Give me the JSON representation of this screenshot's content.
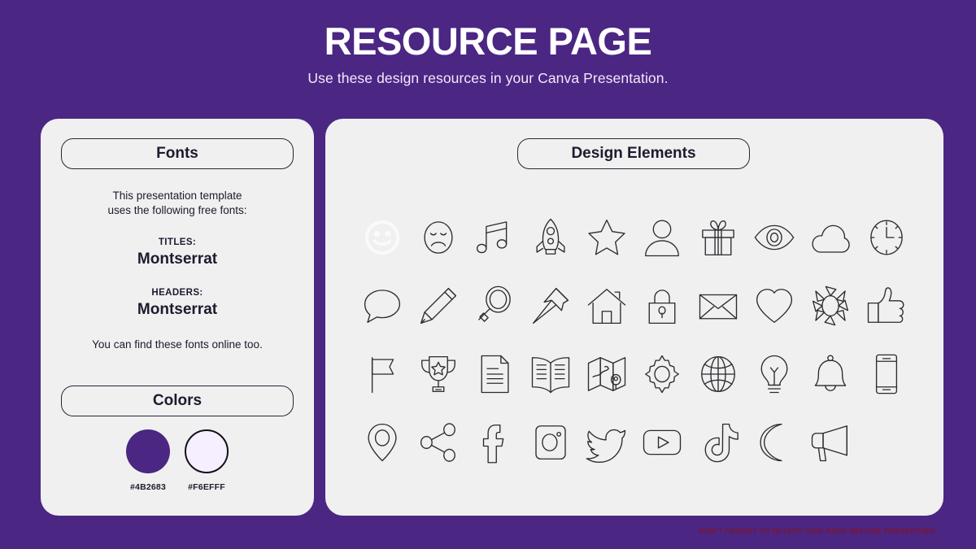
{
  "header": {
    "title": "RESOURCE PAGE",
    "subtitle": "Use these design resources in your Canva Presentation."
  },
  "fonts_panel": {
    "heading": "Fonts",
    "intro": "This presentation template\nuses the following free fonts:",
    "titles_label": "TITLES:",
    "titles_font": "Montserrat",
    "headers_label": "HEADERS:",
    "headers_font": "Montserrat",
    "outro": "You can find these fonts online too."
  },
  "colors_panel": {
    "heading": "Colors",
    "swatches": [
      {
        "hex": "#4B2683",
        "label": "#4B2683",
        "bordered": false
      },
      {
        "hex": "#F6EFFF",
        "label": "#F6EFFF",
        "bordered": true
      }
    ]
  },
  "design_panel": {
    "heading": "Design Elements",
    "icons": [
      {
        "name": "smiley-face-icon",
        "faded": true
      },
      {
        "name": "sad-face-icon",
        "faded": false
      },
      {
        "name": "music-note-icon",
        "faded": false
      },
      {
        "name": "rocket-icon",
        "faded": false
      },
      {
        "name": "star-icon",
        "faded": false
      },
      {
        "name": "user-icon",
        "faded": false
      },
      {
        "name": "gift-icon",
        "faded": false
      },
      {
        "name": "eye-icon",
        "faded": false
      },
      {
        "name": "cloud-icon",
        "faded": false
      },
      {
        "name": "clock-icon",
        "faded": false
      },
      {
        "name": "speech-bubble-icon",
        "faded": false
      },
      {
        "name": "pencil-icon",
        "faded": false
      },
      {
        "name": "magnifier-icon",
        "faded": false
      },
      {
        "name": "pushpin-icon",
        "faded": false
      },
      {
        "name": "house-icon",
        "faded": false
      },
      {
        "name": "lock-icon",
        "faded": false
      },
      {
        "name": "envelope-icon",
        "faded": false
      },
      {
        "name": "heart-icon",
        "faded": false
      },
      {
        "name": "sun-icon",
        "faded": false
      },
      {
        "name": "thumbs-up-icon",
        "faded": false
      },
      {
        "name": "flag-icon",
        "faded": false
      },
      {
        "name": "trophy-icon",
        "faded": false
      },
      {
        "name": "document-icon",
        "faded": false
      },
      {
        "name": "book-icon",
        "faded": false
      },
      {
        "name": "map-icon",
        "faded": false
      },
      {
        "name": "gear-icon",
        "faded": false
      },
      {
        "name": "globe-icon",
        "faded": false
      },
      {
        "name": "lightbulb-icon",
        "faded": false
      },
      {
        "name": "bell-icon",
        "faded": false
      },
      {
        "name": "phone-icon",
        "faded": false
      },
      {
        "name": "location-pin-icon",
        "faded": false
      },
      {
        "name": "share-icon",
        "faded": false
      },
      {
        "name": "facebook-icon",
        "faded": false
      },
      {
        "name": "instagram-icon",
        "faded": false
      },
      {
        "name": "twitter-icon",
        "faded": false
      },
      {
        "name": "youtube-icon",
        "faded": false
      },
      {
        "name": "tiktok-icon",
        "faded": false
      },
      {
        "name": "moon-icon",
        "faded": false
      },
      {
        "name": "megaphone-icon",
        "faded": false
      }
    ]
  },
  "footer": {
    "note": "DON'T FORGET TO DELETE THIS PAGE BEFORE PRESENTING.",
    "color": "#7B1530"
  },
  "theme": {
    "background": "#4B2683",
    "panel_background": "#F0F0F0",
    "text_dark": "#1C1B2E",
    "text_light": "#FFFFFF"
  }
}
